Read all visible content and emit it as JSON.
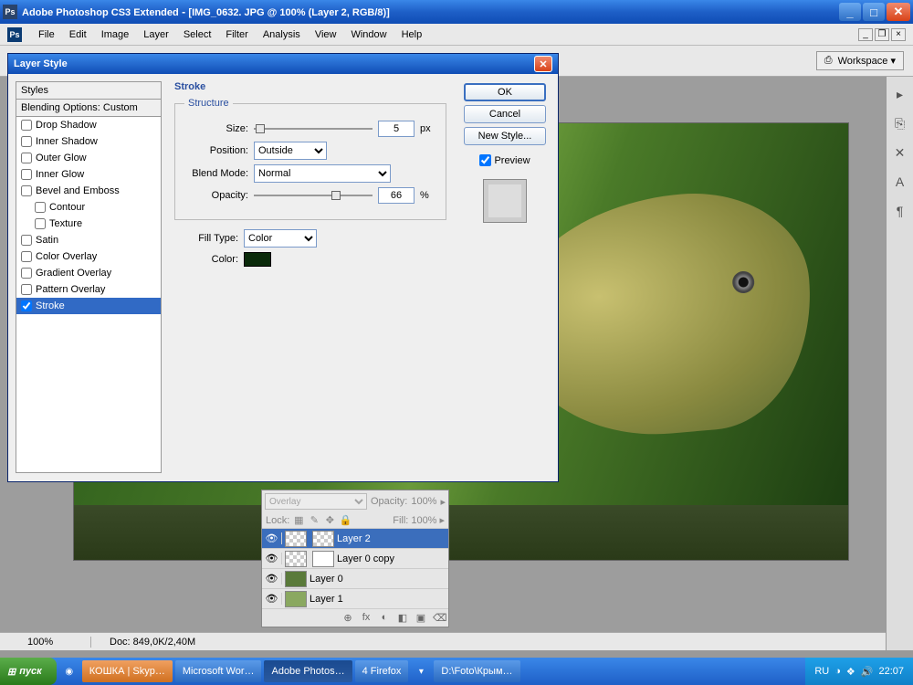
{
  "titlebar": {
    "app": "Adobe Photoshop CS3 Extended",
    "doc": "[IMG_0632. JPG @ 100% (Layer 2, RGB/8)]",
    "icon": "Ps"
  },
  "menu": [
    "File",
    "Edit",
    "Image",
    "Layer",
    "Select",
    "Filter",
    "Analysis",
    "View",
    "Window",
    "Help"
  ],
  "optbar": {
    "workspace": "Workspace ▾"
  },
  "status": {
    "zoom": "100%",
    "doc": "Doc: 849,0K/2,40M"
  },
  "rightdock": [
    "▸",
    "⎘",
    "✕",
    "A",
    "¶"
  ],
  "layerspal": {
    "blend": "Overlay",
    "opacity_lbl": "Opacity:",
    "opacity": "100%",
    "lock_lbl": "Lock:",
    "fill_lbl": "Fill:",
    "fill": "100%",
    "layers": [
      {
        "name": "Layer 2",
        "sel": true
      },
      {
        "name": "Layer 0 copy"
      },
      {
        "name": "Layer 0"
      },
      {
        "name": "Layer 1"
      }
    ],
    "boticons": [
      "⊕",
      "fx",
      "◐",
      "◧",
      "▣",
      "⌫"
    ]
  },
  "dialog": {
    "title": "Layer Style",
    "styles_hdr": "Styles",
    "blend_opts": "Blending Options: Custom",
    "items": [
      {
        "label": "Drop Shadow",
        "chk": false
      },
      {
        "label": "Inner Shadow",
        "chk": false
      },
      {
        "label": "Outer Glow",
        "chk": false
      },
      {
        "label": "Inner Glow",
        "chk": false
      },
      {
        "label": "Bevel and Emboss",
        "chk": false
      },
      {
        "label": "Contour",
        "chk": false,
        "ind": true
      },
      {
        "label": "Texture",
        "chk": false,
        "ind": true
      },
      {
        "label": "Satin",
        "chk": false
      },
      {
        "label": "Color Overlay",
        "chk": false
      },
      {
        "label": "Gradient Overlay",
        "chk": false
      },
      {
        "label": "Pattern Overlay",
        "chk": false
      },
      {
        "label": "Stroke",
        "chk": true,
        "sel": true
      }
    ],
    "section": "Stroke",
    "structure": "Structure",
    "size_lbl": "Size:",
    "size": "5",
    "size_unit": "px",
    "pos_lbl": "Position:",
    "pos": "Outside",
    "blend_lbl": "Blend Mode:",
    "blend": "Normal",
    "opac_lbl": "Opacity:",
    "opac": "66",
    "opac_unit": "%",
    "fill_lbl": "Fill Type:",
    "fill": "Color",
    "color_lbl": "Color:",
    "color": "#0a2a0a",
    "ok": "OK",
    "cancel": "Cancel",
    "newstyle": "New Style...",
    "preview": "Preview"
  },
  "taskbar": {
    "start": "пуск",
    "tasks": [
      {
        "label": "КОШКА | Skyp…",
        "color": "#f0a030"
      },
      {
        "label": "Microsoft Wor…"
      },
      {
        "label": "Adobe Photos…",
        "active": true
      },
      {
        "label": "4 Firefox"
      },
      {
        "label": "D:\\Foto\\Крым…"
      }
    ],
    "tray": {
      "lang": "RU",
      "time": "22:07"
    }
  }
}
